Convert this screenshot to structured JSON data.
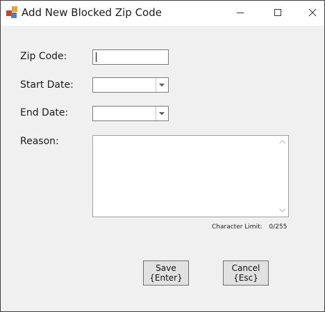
{
  "window": {
    "title": "Add New Blocked Zip Code",
    "icon": "app-icon",
    "controls": [
      "minimize-icon",
      "maximize-icon",
      "close-icon"
    ]
  },
  "form": {
    "zip_label": "Zip Code:",
    "zip_value": "",
    "start_label": "Start Date:",
    "start_value": "",
    "end_label": "End Date:",
    "end_value": "",
    "reason_label": "Reason:",
    "reason_value": "",
    "char_limit_label": "Character Limit:",
    "char_limit_value": "0/255"
  },
  "buttons": {
    "save_label": "Save",
    "save_shortcut": "{Enter}",
    "cancel_label": "Cancel",
    "cancel_shortcut": "{Esc}"
  },
  "colors": {
    "window_bg": "#f0f0f0",
    "titlebar_bg": "#ffffff",
    "icon_orange": "#f0a030",
    "icon_red": "#d04020",
    "icon_blue": "#4a7fd0"
  }
}
